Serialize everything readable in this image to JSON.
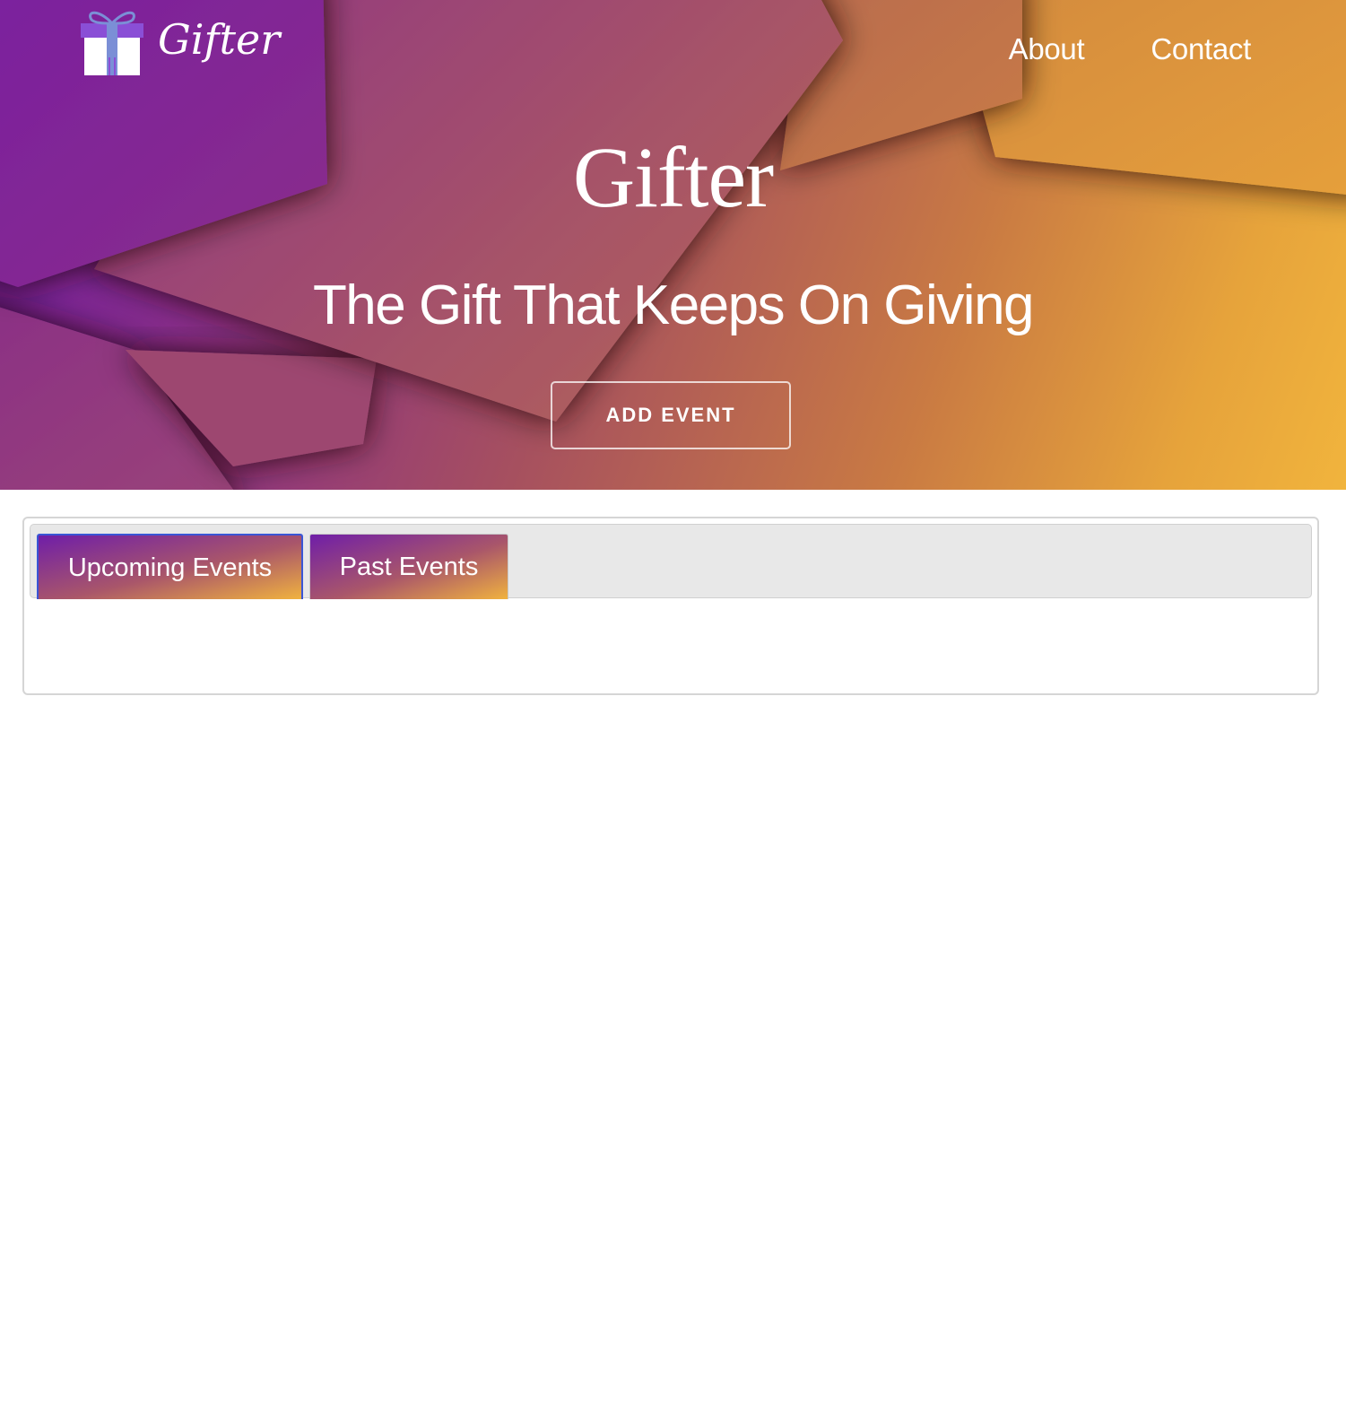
{
  "brand": {
    "logo_text": "Gifter",
    "logo_icon": "gift-box-icon"
  },
  "nav": {
    "about": "About",
    "contact": "Contact"
  },
  "hero": {
    "title": "Gifter",
    "subtitle": "The Gift That Keeps On Giving",
    "add_event_label": "ADD EVENT"
  },
  "tabs": [
    {
      "label": "Upcoming Events",
      "active": true
    },
    {
      "label": "Past Events",
      "active": false
    }
  ],
  "colors": {
    "gradient_start": "#6f1aa6",
    "gradient_mid": "#a6505f",
    "gradient_end": "#f1b43d",
    "active_tab_border": "#3a56d6"
  }
}
